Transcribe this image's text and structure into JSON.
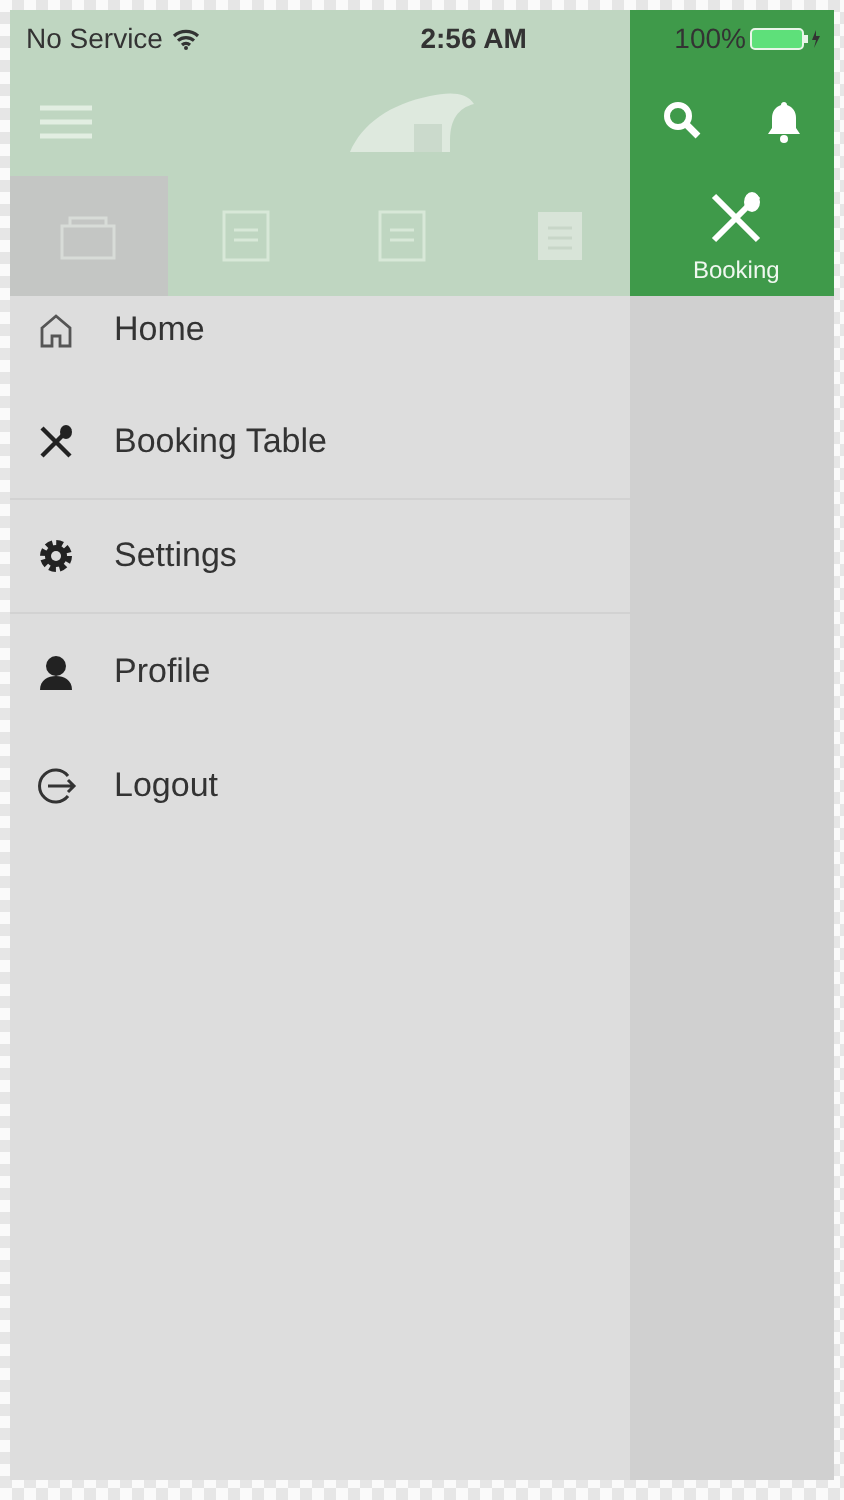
{
  "status_bar": {
    "carrier": "No Service",
    "time": "2:56 AM",
    "battery": "100%"
  },
  "tabs": [
    {
      "selected": true
    },
    {
      "selected": false
    },
    {
      "selected": false
    },
    {
      "selected": false
    },
    {
      "label": "Booking",
      "selected": false
    }
  ],
  "drawer": {
    "items": [
      {
        "label": "Home"
      },
      {
        "label": "Booking Table"
      },
      {
        "label": "Settings"
      },
      {
        "label": "Profile"
      },
      {
        "label": "Logout"
      }
    ]
  }
}
